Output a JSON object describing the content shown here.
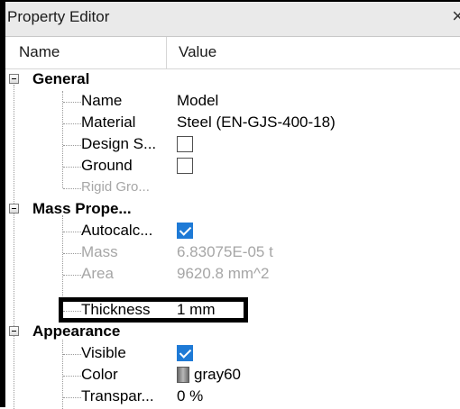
{
  "panel": {
    "title": "Property Editor",
    "close_glyph": "×"
  },
  "columns": {
    "name": "Name",
    "value": "Value"
  },
  "groups": {
    "general": {
      "label": "General",
      "name": {
        "label": "Name",
        "value": "Model"
      },
      "material": {
        "label": "Material",
        "value": "Steel (EN-GJS-400-18)"
      },
      "design_space": {
        "label": "Design S...",
        "checked": false
      },
      "ground": {
        "label": "Ground",
        "checked": false
      },
      "rigid_group": {
        "label": "Rigid Gro..."
      }
    },
    "mass": {
      "label": "Mass Prope...",
      "autocalc": {
        "label": "Autocalc...",
        "checked": true
      },
      "mass": {
        "label": "Mass",
        "value": "6.83075E-05 t"
      },
      "area": {
        "label": "Area",
        "value": "9620.8 mm^2"
      },
      "thickness": {
        "label": "Thickness",
        "value": "1 mm"
      }
    },
    "appearance": {
      "label": "Appearance",
      "visible": {
        "label": "Visible",
        "checked": true
      },
      "color": {
        "label": "Color",
        "value": "gray60",
        "swatch": "#9a9a9a"
      },
      "transparency": {
        "label": "Transpar...",
        "value": "0 %"
      }
    }
  },
  "colors": {
    "check_accent": "#1e7ad6",
    "disabled_text": "#a6a6a6",
    "highlight": "#000000"
  }
}
